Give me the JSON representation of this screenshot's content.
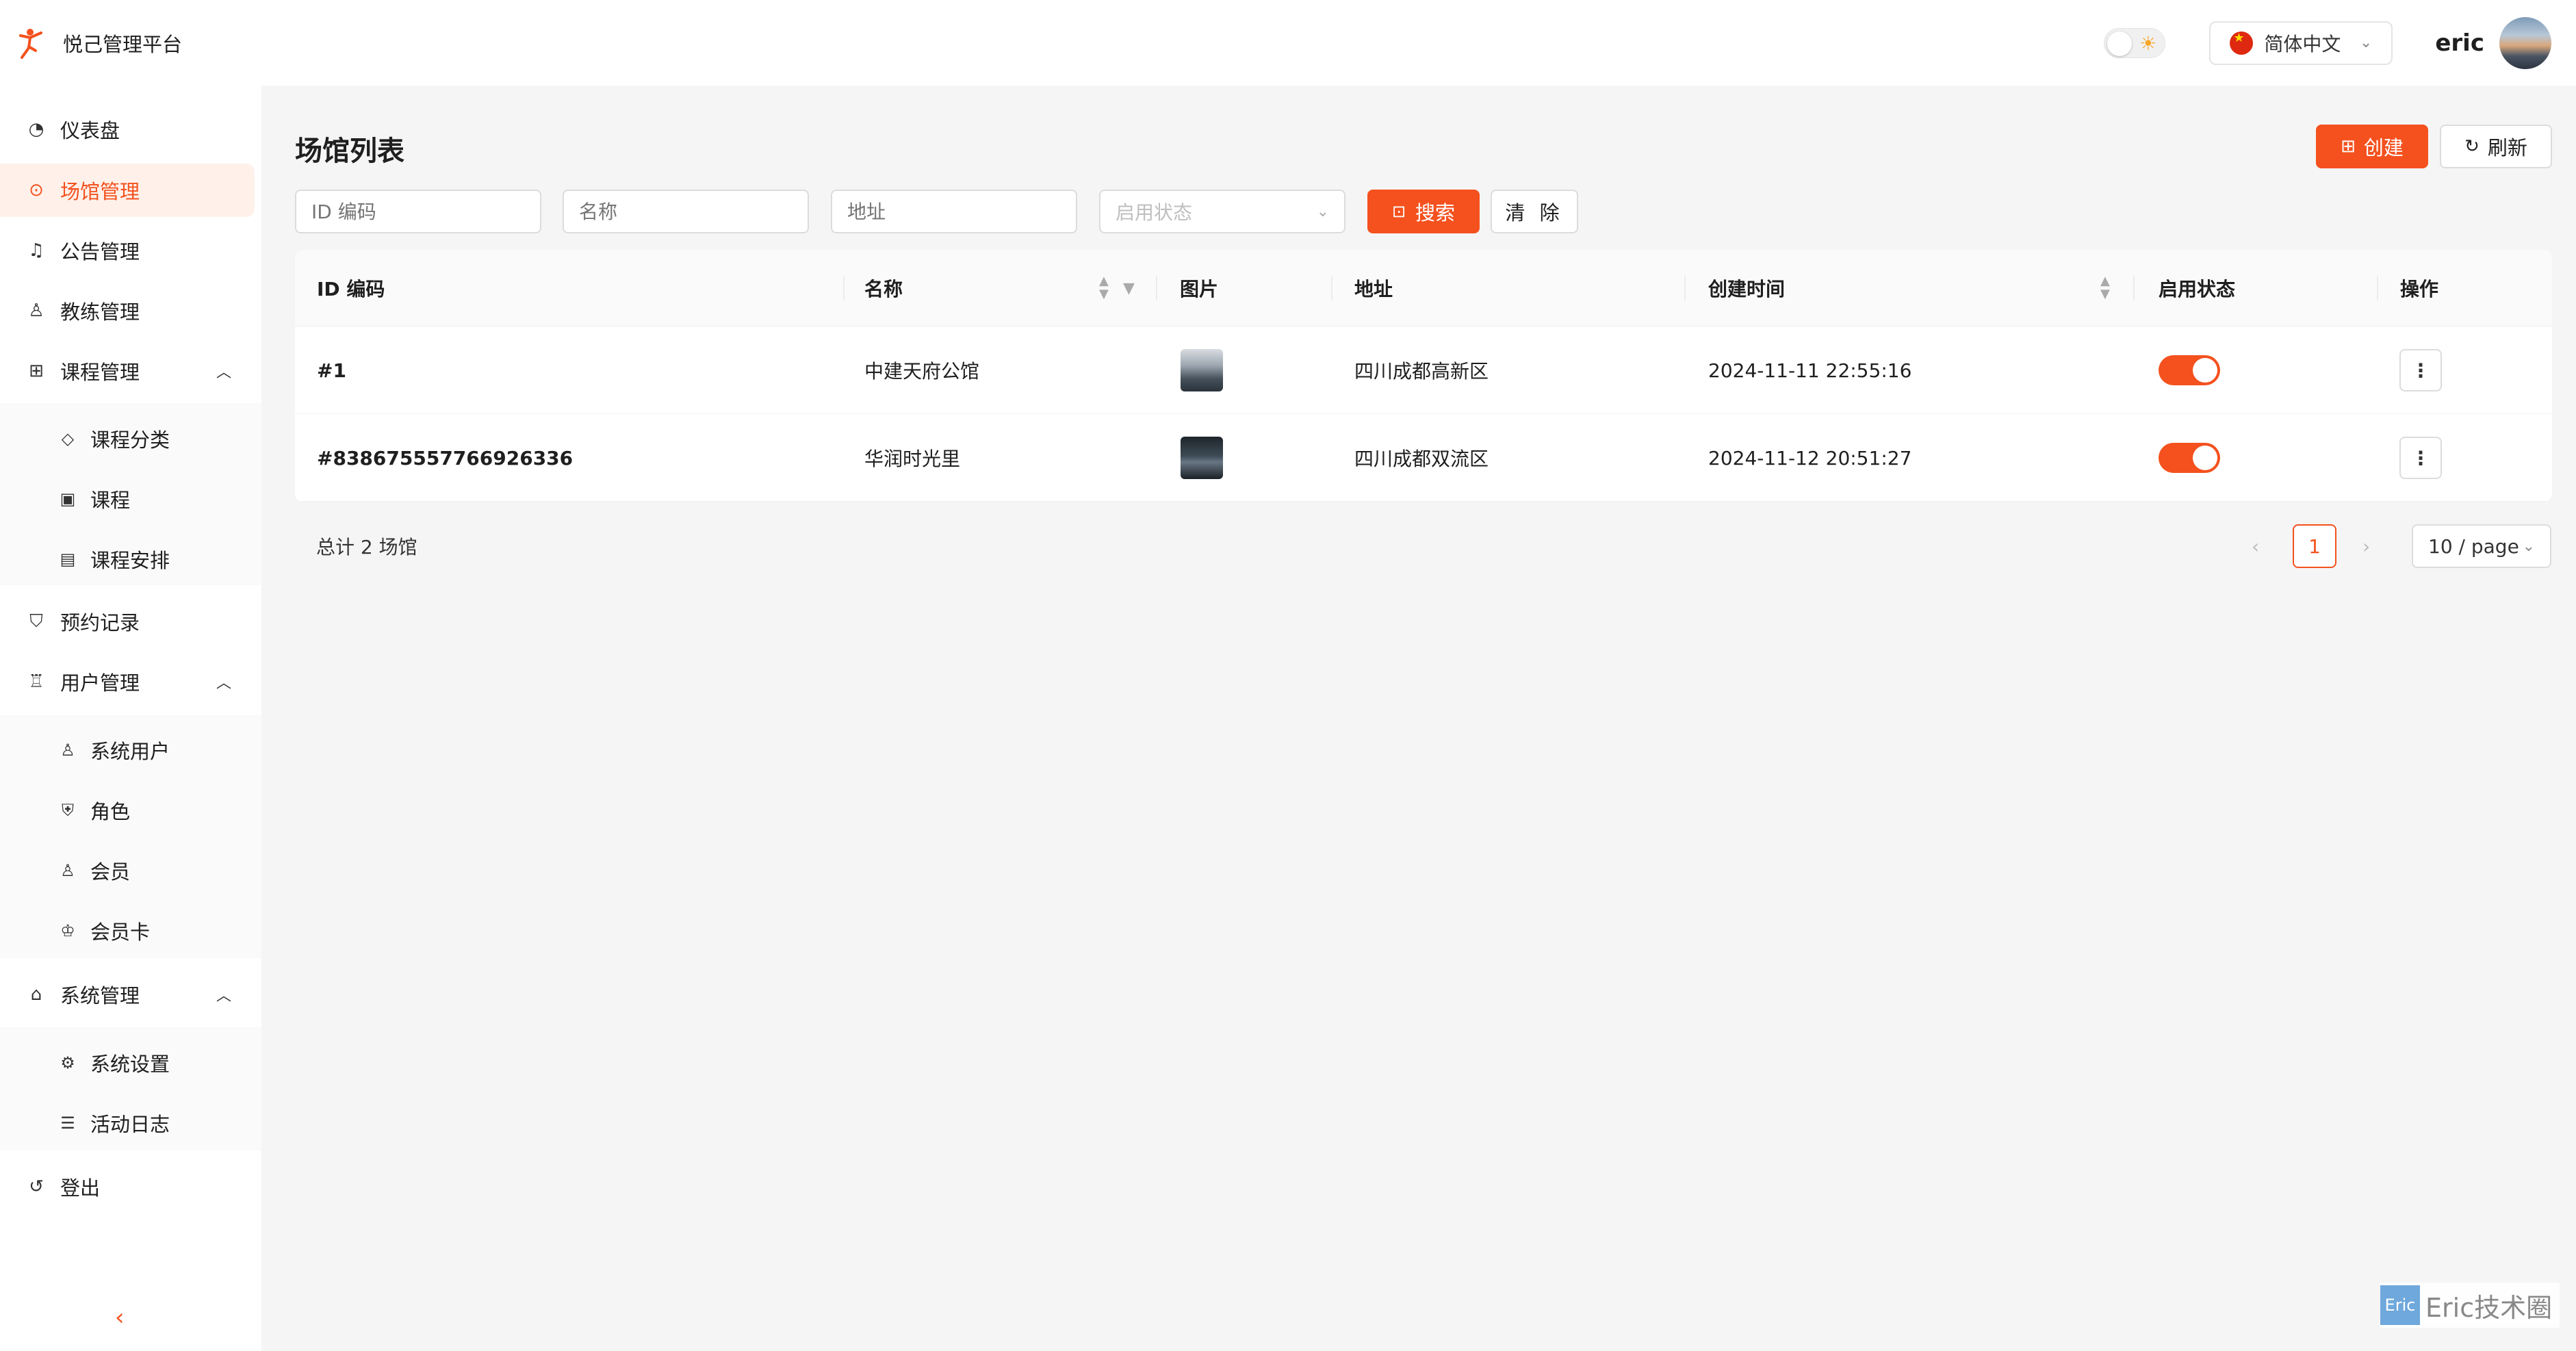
{
  "app": {
    "title": "悦己管理平台"
  },
  "header": {
    "language": "简体中文",
    "username": "eric"
  },
  "sidebar": {
    "items": [
      {
        "label": "仪表盘",
        "icon": "dashboard-icon"
      },
      {
        "label": "场馆管理",
        "icon": "location-icon",
        "active": true
      },
      {
        "label": "公告管理",
        "icon": "bell-icon"
      },
      {
        "label": "教练管理",
        "icon": "user-icon"
      },
      {
        "label": "课程管理",
        "icon": "grid-icon",
        "expanded": true
      },
      {
        "label": "预约记录",
        "icon": "bag-icon"
      },
      {
        "label": "用户管理",
        "icon": "users-icon",
        "expanded": true
      },
      {
        "label": "系统管理",
        "icon": "home-icon",
        "expanded": true
      },
      {
        "label": "登出",
        "icon": "logout-icon"
      }
    ],
    "course_sub": [
      {
        "label": "课程分类",
        "icon": "tag-icon"
      },
      {
        "label": "课程",
        "icon": "calendar-icon"
      },
      {
        "label": "课程安排",
        "icon": "schedule-icon"
      }
    ],
    "user_sub": [
      {
        "label": "系统用户",
        "icon": "user-icon"
      },
      {
        "label": "角色",
        "icon": "shield-icon"
      },
      {
        "label": "会员",
        "icon": "user-icon"
      },
      {
        "label": "会员卡",
        "icon": "card-icon"
      }
    ],
    "system_sub": [
      {
        "label": "系统设置",
        "icon": "gear-icon"
      },
      {
        "label": "活动日志",
        "icon": "list-icon"
      }
    ]
  },
  "main": {
    "title": "场馆列表",
    "create_label": "创建",
    "refresh_label": "刷新",
    "filters": {
      "id_placeholder": "ID 编码",
      "name_placeholder": "名称",
      "address_placeholder": "地址",
      "status_placeholder": "启用状态"
    },
    "search_label": "搜索",
    "clear_label": "清 除",
    "table": {
      "columns": [
        "ID 编码",
        "名称",
        "图片",
        "地址",
        "创建时间",
        "启用状态",
        "操作"
      ],
      "rows": [
        {
          "id": "#1",
          "name": "中建天府公馆",
          "address": "四川成都高新区",
          "created": "2024-11-11 22:55:16",
          "enabled": true
        },
        {
          "id": "#838675557766926336",
          "name": "华润时光里",
          "address": "四川成都双流区",
          "created": "2024-11-12 20:51:27",
          "enabled": true
        }
      ]
    },
    "total_text": "总计 2 场馆",
    "pagination": {
      "current_page": "1",
      "page_size": "10 / page"
    }
  },
  "watermark": {
    "badge": "Eric",
    "text": "Eric技术圈"
  },
  "colors": {
    "accent": "#f4511e",
    "active_bg": "#fff1ea"
  }
}
